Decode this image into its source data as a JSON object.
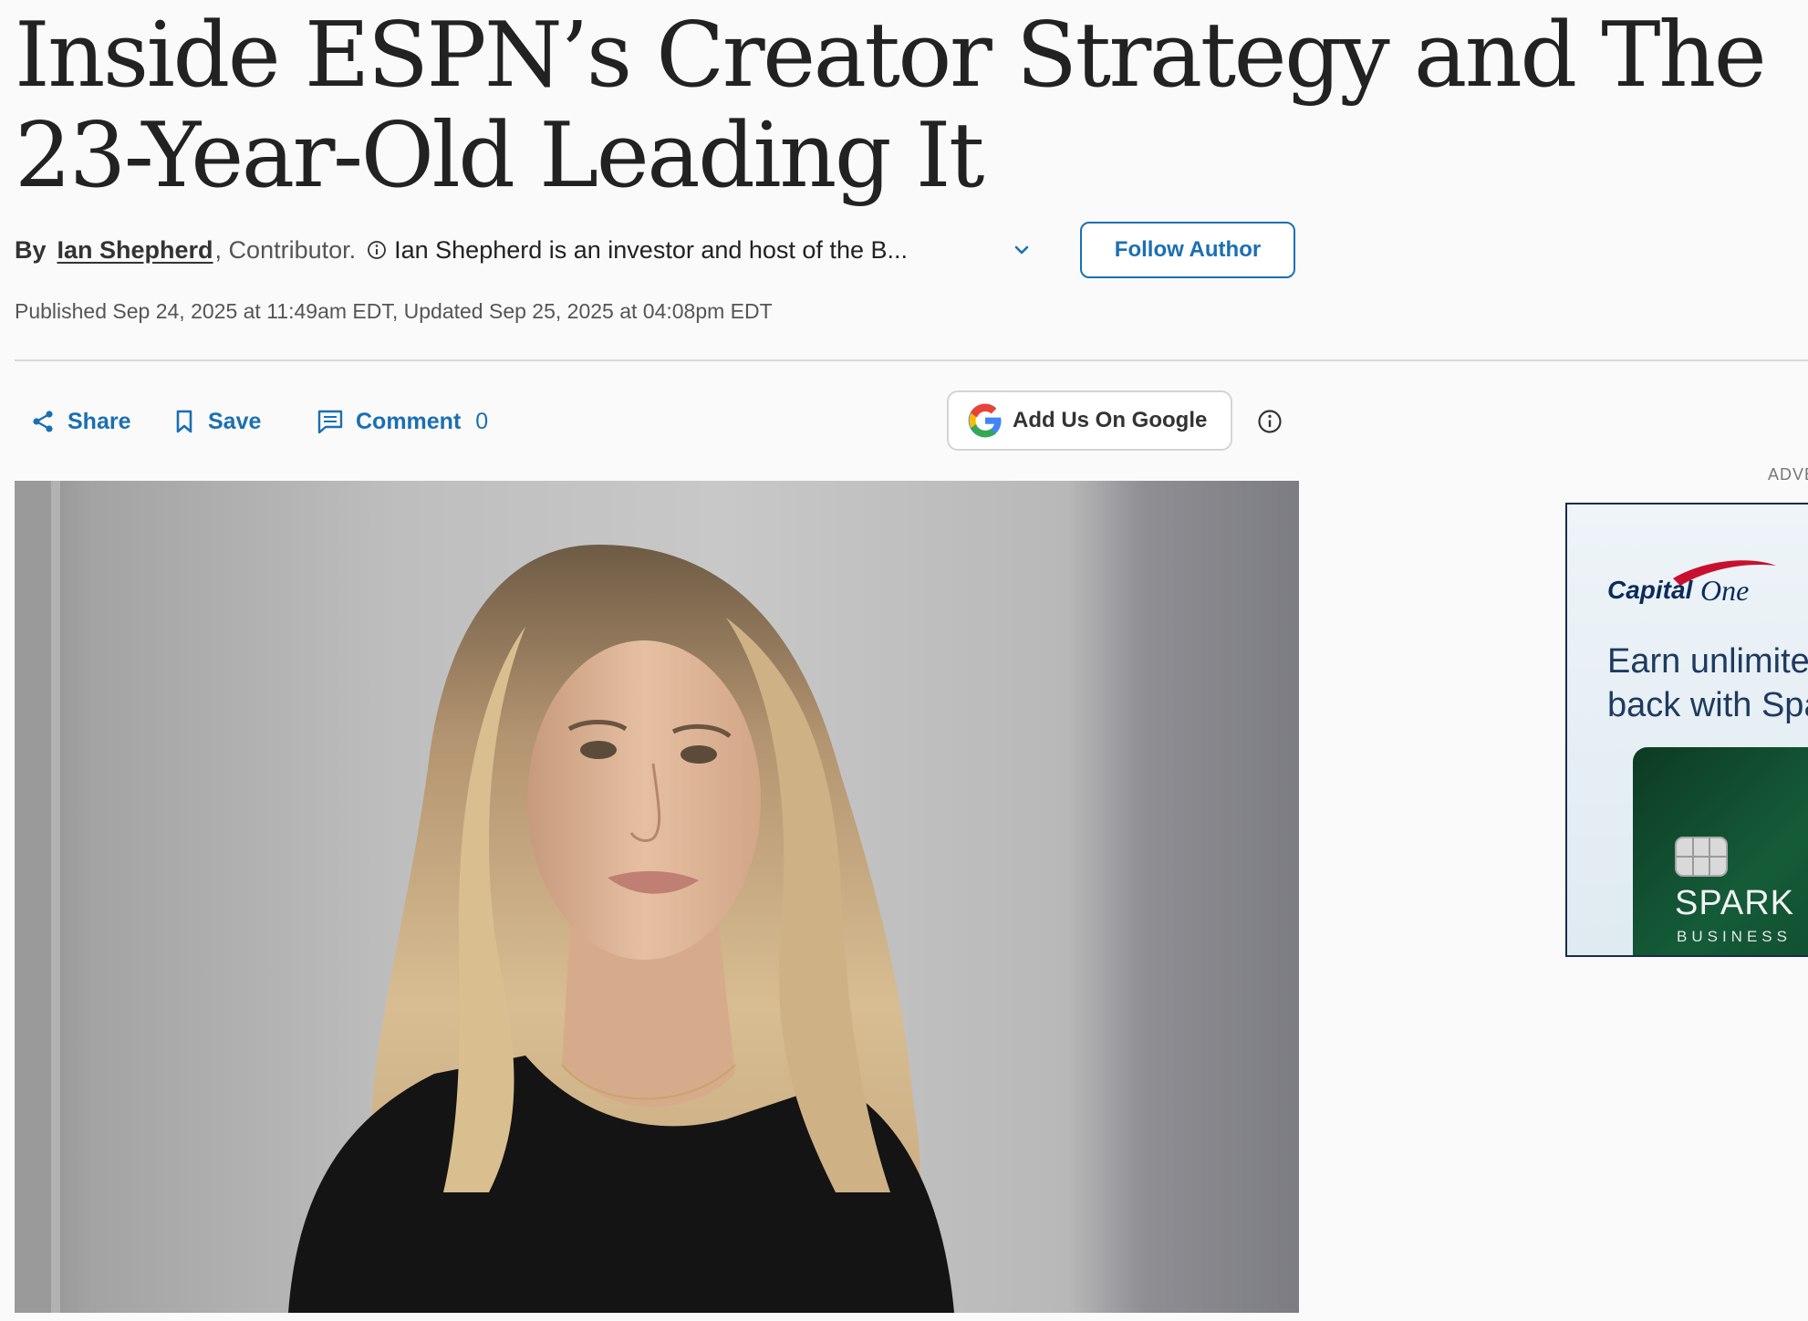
{
  "article": {
    "headline": "Inside ESPN’s Creator Strategy and The 23-Year-Old Leading It",
    "byline": {
      "by_label": "By",
      "author": "Ian Shepherd",
      "role": ", Contributor.",
      "bio": "Ian Shepherd is an investor and host of the B...",
      "follow_label": "Follow Author"
    },
    "dates": "Published Sep 24, 2025 at 11:49am EDT, Updated Sep 25, 2025 at 04:08pm EDT"
  },
  "actions": {
    "share_label": "Share",
    "save_label": "Save",
    "comment_label": "Comment",
    "comment_count": "0",
    "google_label": "Add Us On Google"
  },
  "hero": {
    "icon": "portrait-photo"
  },
  "ad": {
    "label": "ADVE",
    "brand": "Capital One",
    "brand_lettering": "CapitalOne",
    "text_line1": "Earn unlimitec",
    "text_line2": "back with Spa",
    "card_name": "SPARK",
    "card_sub": "BUSINESS"
  },
  "colors": {
    "link_blue": "#1b6fb3",
    "text_dark": "#222222",
    "ad_navy": "#1e3a5f",
    "ad_card_green": "#145c38"
  }
}
